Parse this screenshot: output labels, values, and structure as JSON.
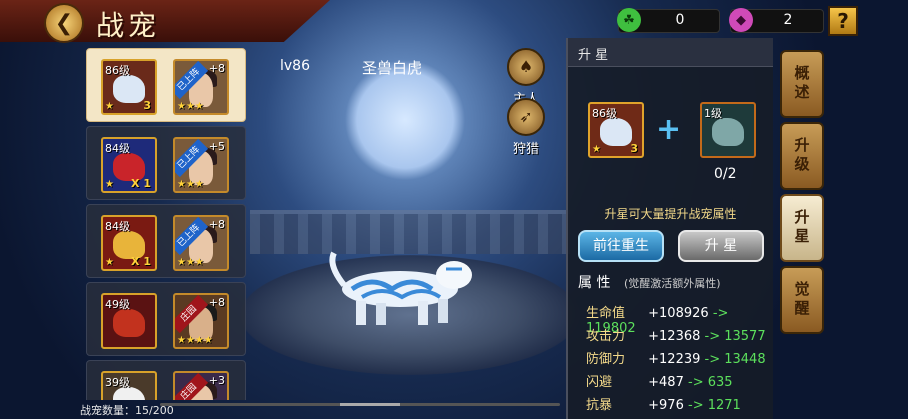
{
  "title": "战宠",
  "currency": [
    {
      "icon": "jade-icon",
      "value": "0",
      "color": "#3fbf3f"
    },
    {
      "icon": "gem-icon",
      "value": "2",
      "color": "#d04ab8"
    }
  ],
  "help": "?",
  "pets": [
    {
      "level": "86级",
      "count": "3",
      "hero_tag": "已上阵",
      "hero_plus": "+8",
      "selected": true,
      "pet_color": "#dbe7f5"
    },
    {
      "level": "84级",
      "count": "X 1",
      "hero_tag": "已上阵",
      "hero_plus": "+5",
      "selected": false,
      "pet_color": "#c9242a"
    },
    {
      "level": "84级",
      "count": "X 1",
      "hero_tag": "已上阵",
      "hero_plus": "+8",
      "selected": false,
      "pet_color": "#e8b43a"
    },
    {
      "level": "49级",
      "count": "",
      "hero_tag": "庄园",
      "hero_plus": "+8",
      "selected": false,
      "pet_color": "#c2321e"
    },
    {
      "level": "39级",
      "count": "",
      "hero_tag": "庄园",
      "hero_plus": "+3",
      "selected": false,
      "pet_color": "#f0f0f0"
    }
  ],
  "pet_count_label": "战宠数量：15/200",
  "stage": {
    "level": "lv86",
    "name": "圣兽白虎"
  },
  "side_buttons": [
    {
      "label": "主人",
      "icon": "helmet-icon"
    },
    {
      "label": "狩猎",
      "icon": "bow-icon"
    }
  ],
  "panel": {
    "title": "升 星",
    "current": {
      "level": "86级",
      "count": "3"
    },
    "target": {
      "level": "1级"
    },
    "need": "0/2",
    "hint": "升星可大量提升战宠属性",
    "btn_rebirth": "前往重生",
    "btn_star": "升 星",
    "attr_title": "属 性",
    "attr_note": "(觉醒激活额外属性)",
    "attrs": [
      {
        "name": "生命值",
        "cur": "+108926",
        "next": "-> 119802"
      },
      {
        "name": "攻击力",
        "cur": "+12368",
        "next": "-> 13577"
      },
      {
        "name": "防御力",
        "cur": "+12239",
        "next": "-> 13448"
      },
      {
        "name": "闪避",
        "cur": "+487",
        "next": "-> 635"
      },
      {
        "name": "抗暴",
        "cur": "+976",
        "next": "-> 1271"
      }
    ]
  },
  "tabs": [
    "概述",
    "升级",
    "升星",
    "觉醒"
  ],
  "active_tab": "升星"
}
